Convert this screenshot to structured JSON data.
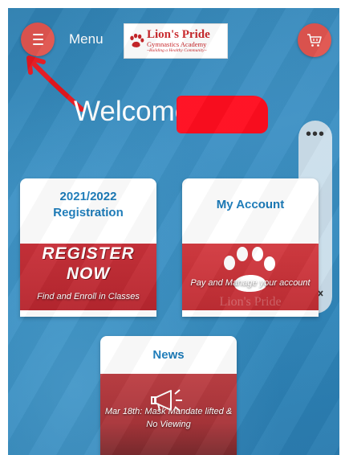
{
  "header": {
    "menu_label": "Menu",
    "logo_line1": "Lion's Pride",
    "logo_line2": "Gymnastics Academy",
    "logo_tagline": "~Building a Healthy Community~"
  },
  "welcome": {
    "text": "Welcome,"
  },
  "side_widget": {
    "more": "•••"
  },
  "cards": {
    "registration": {
      "title_line1": "2021/2022",
      "title_line2": "Registration",
      "image_word1": "REGISTER",
      "image_word2": "NOW",
      "caption": "Find and Enroll in Classes"
    },
    "account": {
      "title": "My Account",
      "caption": "Pay and Manage your account",
      "watermark": "Lion's Pride"
    },
    "news": {
      "title": "News",
      "caption": "Mar 18th: Mask Mandate lifted & No Viewing"
    }
  },
  "colors": {
    "accent_red": "#e0554f",
    "title_blue": "#1a7ab8",
    "redaction": "#ff0d1f"
  },
  "icons": [
    "menu-icon",
    "cart-icon",
    "paw-icon",
    "megaphone-icon",
    "speaker-muted-icon",
    "more-dots-icon"
  ]
}
